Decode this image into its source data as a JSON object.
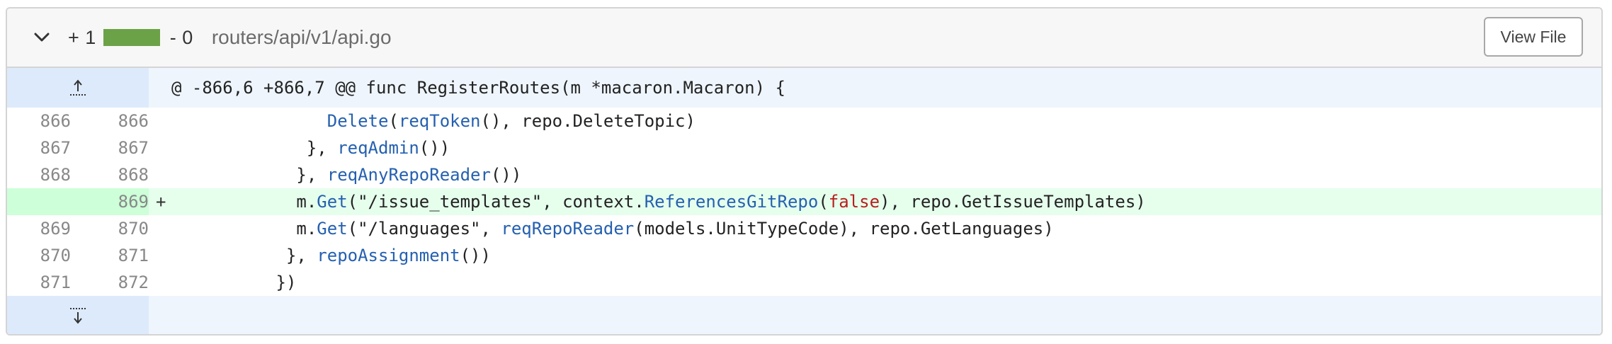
{
  "file": {
    "additions_label": "+ 1",
    "deletions_label": "- 0",
    "add_ratio": 1.0,
    "path": "routers/api/v1/api.go",
    "view_file_label": "View File",
    "add_color": "#6ca247",
    "del_color": "#e5e5e5"
  },
  "hunk": {
    "header": "@ -866,6 +866,7 @@ func RegisterRoutes(m *macaron.Macaron) {"
  },
  "lines": [
    {
      "old": "866",
      "new": "866",
      "sign": "",
      "type": "context"
    },
    {
      "old": "867",
      "new": "867",
      "sign": "",
      "type": "context"
    },
    {
      "old": "868",
      "new": "868",
      "sign": "",
      "type": "context"
    },
    {
      "old": "",
      "new": "869",
      "sign": "+",
      "type": "add"
    },
    {
      "old": "869",
      "new": "870",
      "sign": "",
      "type": "context"
    },
    {
      "old": "870",
      "new": "871",
      "sign": "",
      "type": "context"
    },
    {
      "old": "871",
      "new": "872",
      "sign": "",
      "type": "context"
    }
  ],
  "code": {
    "l0": {
      "indent": "               ",
      "t1": "Delete",
      "t2": "(",
      "t3": "reqToken",
      "t4": "(), repo.DeleteTopic)"
    },
    "l1": {
      "indent": "             ",
      "t1": "}, ",
      "t2": "reqAdmin",
      "t3": "())"
    },
    "l2": {
      "indent": "            ",
      "t1": "}, ",
      "t2": "reqAnyRepoReader",
      "t3": "())"
    },
    "l3": {
      "indent": "            ",
      "t1": "m.",
      "t2": "Get",
      "t3": "(\"/issue_templates\", context.",
      "t4": "ReferencesGitRepo",
      "t5": "(",
      "t6": "false",
      "t7": "), repo.GetIssueTemplates)"
    },
    "l4": {
      "indent": "            ",
      "t1": "m.",
      "t2": "Get",
      "t3": "(\"/languages\", ",
      "t4": "reqRepoReader",
      "t5": "(models.UnitTypeCode), repo.GetLanguages)"
    },
    "l5": {
      "indent": "           ",
      "t1": "}, ",
      "t2": "repoAssignment",
      "t3": "())"
    },
    "l6": {
      "indent": "          ",
      "t1": "})"
    }
  },
  "icons": {
    "collapse": "chevron-down-icon",
    "expand_up": "fold-up-icon",
    "expand_down": "fold-down-icon"
  }
}
